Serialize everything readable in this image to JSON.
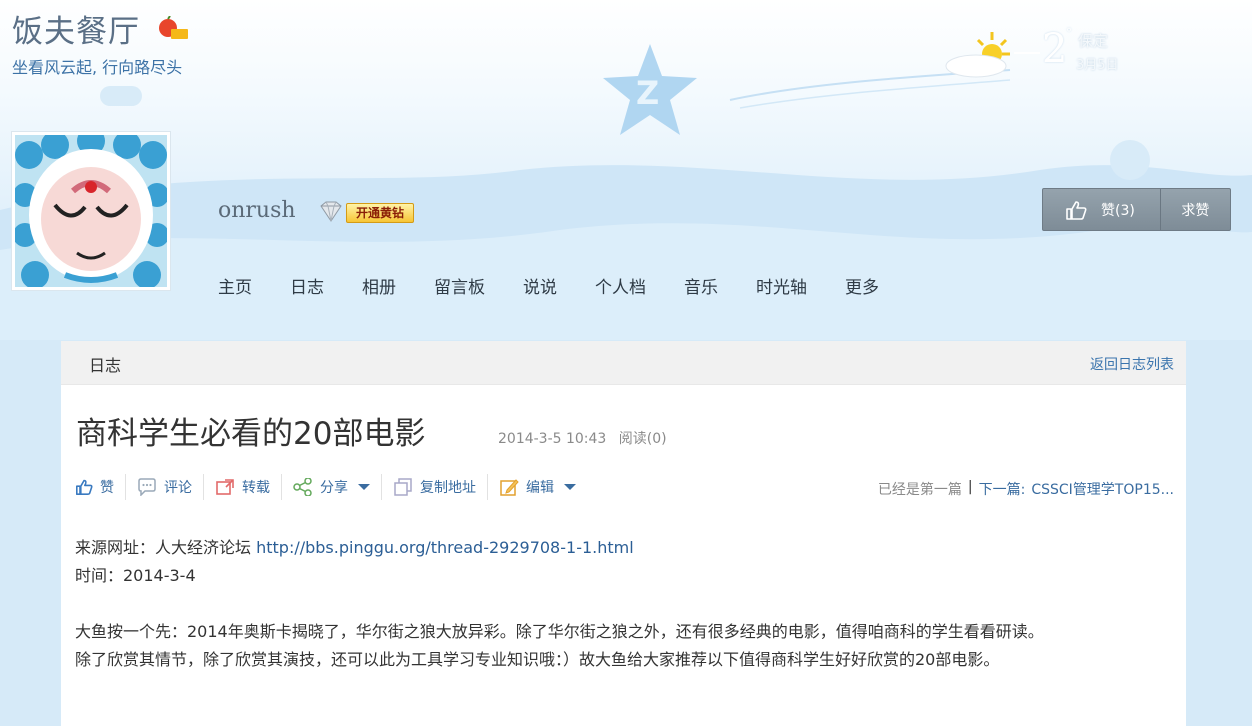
{
  "site": {
    "title": "饭夫餐厅",
    "subtitle": "坐看风云起, 行向路尽头"
  },
  "weather": {
    "temperature": "2",
    "degree": "°",
    "city": "保定",
    "date": "3月5日"
  },
  "profile": {
    "username": "onrush",
    "vip_label": "开通黄钻"
  },
  "nav": {
    "items": [
      "主页",
      "日志",
      "相册",
      "留言板",
      "说说",
      "个人档",
      "音乐",
      "时光轴",
      "更多"
    ]
  },
  "like_box": {
    "like_label": "赞(3)",
    "request_label": "求赞"
  },
  "panel": {
    "title": "日志",
    "back_link": "返回日志列表"
  },
  "post": {
    "title": "商科学生必看的20部电影",
    "date": "2014-3-5 10:43",
    "reads": "阅读(0)"
  },
  "toolbar": {
    "like": "赞",
    "comment": "评论",
    "repost": "转载",
    "share": "分享",
    "copy_link": "复制地址",
    "edit": "编辑"
  },
  "pager": {
    "first": "已经是第一篇",
    "separator": "|",
    "next_prefix": "下一篇:",
    "next_title": "CSSCI管理学TOP15..."
  },
  "content": {
    "source_label": "来源网址：人大经济论坛 ",
    "source_url": "http://bbs.pinggu.org/thread-2929708-1-1.html",
    "time_line": "时间：2014-3-4",
    "para_line1": "大鱼按一个先：2014年奥斯卡揭晓了，华尔街之狼大放异彩。除了华尔街之狼之外，还有很多经典的电影，值得咱商科的学生看看研读。",
    "para_line2": "除了欣赏其情节，除了欣赏其演技，还可以此为工具学习专业知识哦：）故大鱼给大家推荐以下值得商科学生好好欣赏的20部电影。"
  },
  "colors": {
    "link": "#3a6ca0",
    "vip": "#f7c535",
    "sky": "#d6eaf8"
  }
}
